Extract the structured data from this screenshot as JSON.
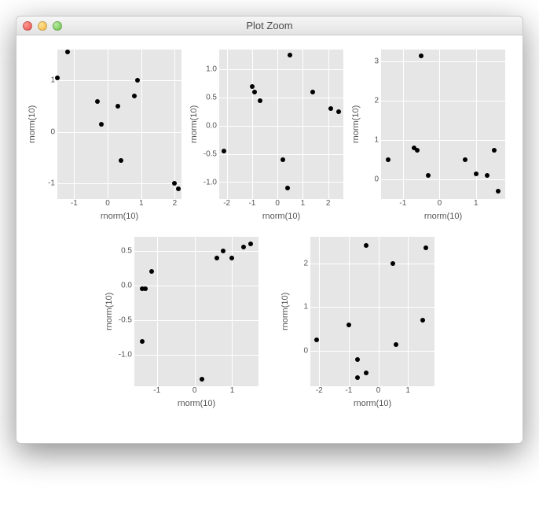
{
  "window": {
    "title": "Plot Zoom"
  },
  "traffic_lights": {
    "close": "close-icon",
    "minimize": "minimize-icon",
    "zoom": "zoom-icon"
  },
  "axis": {
    "xlabel": "rnorm(10)",
    "ylabel": "rnorm(10)"
  },
  "chart_data": [
    {
      "type": "scatter",
      "xlabel": "rnorm(10)",
      "ylabel": "rnorm(10)",
      "xlim": [
        -1.5,
        2.2
      ],
      "ylim": [
        -1.3,
        1.6
      ],
      "x_ticks": [
        -1,
        0,
        1,
        2
      ],
      "y_ticks": [
        -1,
        0,
        1
      ],
      "x": [
        -1.5,
        -1.2,
        -0.3,
        -0.2,
        0.3,
        0.4,
        0.8,
        0.9,
        2.0,
        2.1
      ],
      "y": [
        1.05,
        1.55,
        0.6,
        0.15,
        0.5,
        -0.55,
        0.7,
        1.0,
        -1.0,
        -1.1
      ]
    },
    {
      "type": "scatter",
      "xlabel": "rnorm(10)",
      "ylabel": "rnorm(10)",
      "xlim": [
        -2.3,
        2.6
      ],
      "ylim": [
        -1.3,
        1.35
      ],
      "x_ticks": [
        -2,
        -1,
        0,
        1,
        2
      ],
      "y_ticks": [
        -1.0,
        -0.5,
        0.0,
        0.5,
        1.0
      ],
      "x": [
        -2.1,
        -1.0,
        -0.9,
        -0.7,
        0.2,
        0.4,
        0.5,
        1.4,
        2.1,
        2.4
      ],
      "y": [
        -0.45,
        0.7,
        0.6,
        0.45,
        -0.6,
        -1.1,
        1.25,
        0.6,
        0.3,
        0.25
      ]
    },
    {
      "type": "scatter",
      "xlabel": "rnorm(10)",
      "ylabel": "rnorm(10)",
      "xlim": [
        -1.6,
        1.8
      ],
      "ylim": [
        -0.5,
        3.3
      ],
      "x_ticks": [
        -1,
        0,
        1
      ],
      "y_ticks": [
        0,
        1,
        2,
        3
      ],
      "x": [
        -1.4,
        -0.7,
        -0.6,
        -0.3,
        -0.5,
        0.7,
        1.0,
        1.3,
        1.5,
        1.6
      ],
      "y": [
        0.5,
        0.8,
        0.75,
        0.1,
        3.15,
        0.5,
        0.15,
        0.1,
        0.75,
        -0.3
      ]
    },
    {
      "type": "scatter",
      "xlabel": "rnorm(10)",
      "ylabel": "rnorm(10)",
      "xlim": [
        -1.6,
        1.7
      ],
      "ylim": [
        -1.45,
        0.7
      ],
      "x_ticks": [
        -1,
        0,
        1
      ],
      "y_ticks": [
        -1.0,
        -0.5,
        0.0,
        0.5
      ],
      "x": [
        -1.4,
        -1.4,
        -1.3,
        -1.15,
        0.2,
        0.6,
        0.75,
        1.0,
        1.3,
        1.5
      ],
      "y": [
        -0.05,
        -0.8,
        -0.05,
        0.2,
        -1.35,
        0.4,
        0.5,
        0.4,
        0.55,
        0.6
      ]
    },
    {
      "type": "scatter",
      "xlabel": "rnorm(10)",
      "ylabel": "rnorm(10)",
      "xlim": [
        -2.3,
        1.9
      ],
      "ylim": [
        -0.8,
        2.6
      ],
      "x_ticks": [
        -2,
        -1,
        0,
        1
      ],
      "y_ticks": [
        0,
        1,
        2
      ],
      "x": [
        -2.1,
        -1.0,
        -0.7,
        -0.7,
        -0.4,
        -0.4,
        0.6,
        0.5,
        1.5,
        1.6
      ],
      "y": [
        0.25,
        0.6,
        -0.2,
        -0.6,
        -0.5,
        2.4,
        0.15,
        2.0,
        0.7,
        2.35
      ]
    }
  ]
}
